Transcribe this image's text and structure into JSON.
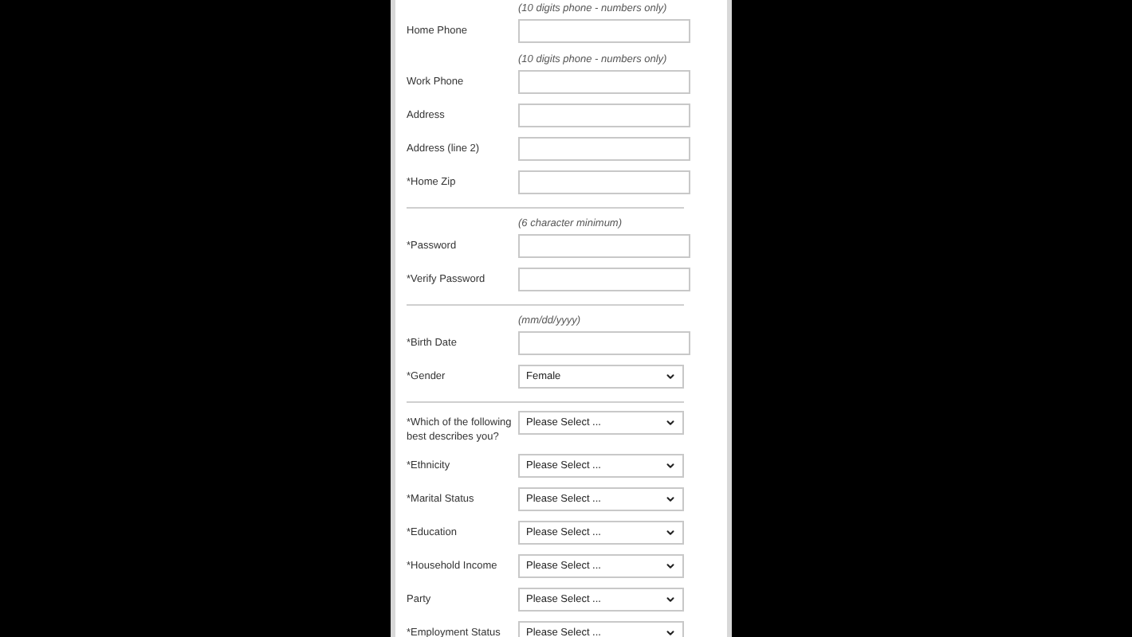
{
  "sections": [
    {
      "rows": [
        {
          "kind": "text",
          "label": "Home Phone",
          "hint": "(10 digits phone - numbers only)"
        },
        {
          "kind": "text",
          "label": "Work Phone",
          "hint": "(10 digits phone - numbers only)"
        },
        {
          "kind": "text",
          "label": "Address"
        },
        {
          "kind": "text",
          "label": "Address (line 2)"
        },
        {
          "kind": "text",
          "label": "*Home Zip"
        }
      ]
    },
    {
      "rows": [
        {
          "kind": "text",
          "label": "*Password",
          "hint": "(6 character minimum)"
        },
        {
          "kind": "text",
          "label": "*Verify Password"
        }
      ]
    },
    {
      "rows": [
        {
          "kind": "text",
          "label": "*Birth Date",
          "hint": "(mm/dd/yyyy)"
        },
        {
          "kind": "select",
          "label": "*Gender",
          "value": "Female"
        }
      ]
    },
    {
      "rows": [
        {
          "kind": "select",
          "label": "*Which of the following best describes you?",
          "value": "Please Select ..."
        },
        {
          "kind": "select",
          "label": "*Ethnicity",
          "value": "Please Select ..."
        },
        {
          "kind": "select",
          "label": "*Marital Status",
          "value": "Please Select ..."
        },
        {
          "kind": "select",
          "label": "*Education",
          "value": "Please Select ..."
        },
        {
          "kind": "select",
          "label": "*Household Income",
          "value": "Please Select ..."
        },
        {
          "kind": "select",
          "label": "Party",
          "value": "Please Select ..."
        },
        {
          "kind": "select",
          "label": "*Employment Status",
          "value": "Please Select ..."
        }
      ]
    }
  ]
}
